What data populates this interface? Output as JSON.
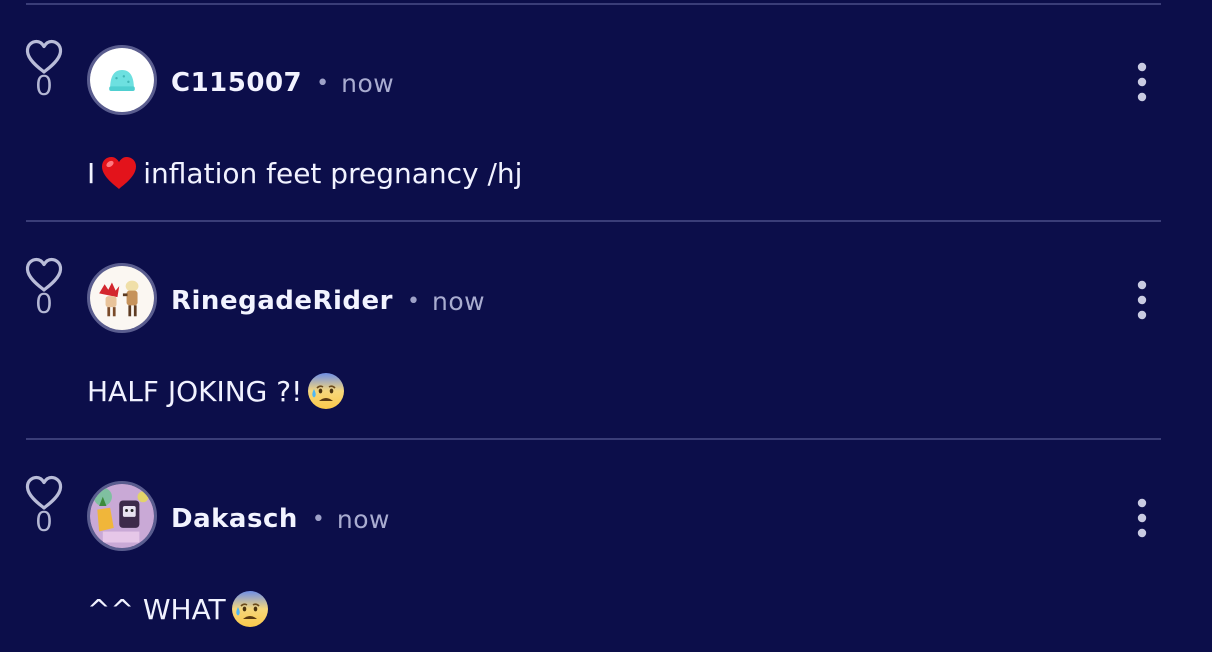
{
  "comments": [
    {
      "likes": "0",
      "username": "C115007",
      "separator": "•",
      "time": "now",
      "text_before": "I",
      "text_emoji": "red-heart-emoji",
      "text_after": "inflation feet pregnancy /hj"
    },
    {
      "likes": "0",
      "username": "RinegadeRider",
      "separator": "•",
      "time": "now",
      "text_before": "HALF JOKING ?!",
      "text_emoji": "anxious-face-with-sweat-emoji",
      "text_after": ""
    },
    {
      "likes": "0",
      "username": "Dakasch",
      "separator": "•",
      "time": "now",
      "text_before": "^^ WHAT",
      "text_emoji": "anxious-face-with-sweat-emoji",
      "text_after": ""
    }
  ],
  "colors": {
    "background": "#0c0e4a",
    "divider": "#3a3d78",
    "text": "#f1f2ff",
    "muted": "#a9acd0"
  },
  "icons": {
    "like": "heart-outline-icon",
    "menu": "more-vertical-icon"
  }
}
